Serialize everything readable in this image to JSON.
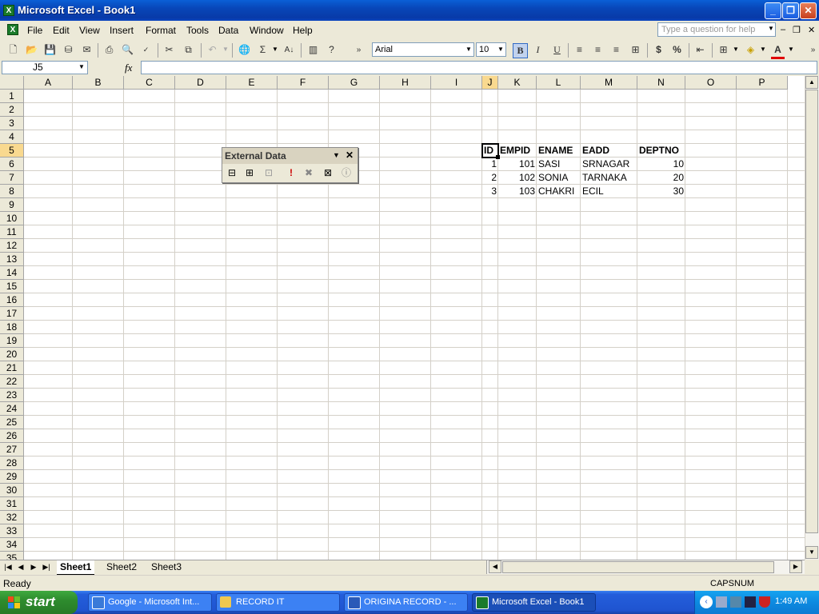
{
  "window": {
    "title": "Microsoft Excel - Book1"
  },
  "menu": [
    "File",
    "Edit",
    "View",
    "Insert",
    "Format",
    "Tools",
    "Data",
    "Window",
    "Help"
  ],
  "help_placeholder": "Type a question for help",
  "toolbar": {
    "font": "Arial",
    "size": "10",
    "bold": "B",
    "italic": "I",
    "underline": "U",
    "currency": "$",
    "percent": "%"
  },
  "formula": {
    "name_box": "J5",
    "fx": "fx",
    "content": ""
  },
  "columns": [
    "A",
    "B",
    "C",
    "D",
    "E",
    "F",
    "G",
    "H",
    "I",
    "J",
    "K",
    "L",
    "M",
    "N",
    "O",
    "P"
  ],
  "rows": [
    "1",
    "2",
    "3",
    "4",
    "5",
    "6",
    "7",
    "8",
    "9",
    "10",
    "11",
    "12",
    "13",
    "14",
    "15",
    "16",
    "17",
    "18",
    "19",
    "20",
    "21",
    "22",
    "23",
    "24",
    "25",
    "26",
    "27",
    "28",
    "29",
    "30",
    "31",
    "32",
    "33",
    "34",
    "35"
  ],
  "table": {
    "headers": [
      "ID",
      "EMPID",
      "ENAME",
      "EADD",
      "DEPTNO"
    ],
    "rows": [
      [
        "1",
        "101",
        "SASI",
        "SRNAGAR",
        "10"
      ],
      [
        "2",
        "102",
        "SONIA",
        "TARNAKA",
        "20"
      ],
      [
        "3",
        "103",
        "CHAKRI",
        "ECIL",
        "30"
      ]
    ]
  },
  "external_data": {
    "title": "External Data"
  },
  "sheets": [
    "Sheet1",
    "Sheet2",
    "Sheet3"
  ],
  "status": {
    "ready": "Ready",
    "caps": "CAPS",
    "num": "NUM"
  },
  "taskbar": {
    "start": "start",
    "tasks": [
      "Google - Microsoft Int...",
      "RECORD IT",
      "ORIGINA RECORD - ...",
      "Microsoft Excel - Book1"
    ],
    "clock": "1:49 AM"
  },
  "colors": {
    "selection_header": "#f9d98f",
    "titlebar": "#0a5fd6",
    "taskbar": "#245edb",
    "start": "#2e8c2e"
  }
}
